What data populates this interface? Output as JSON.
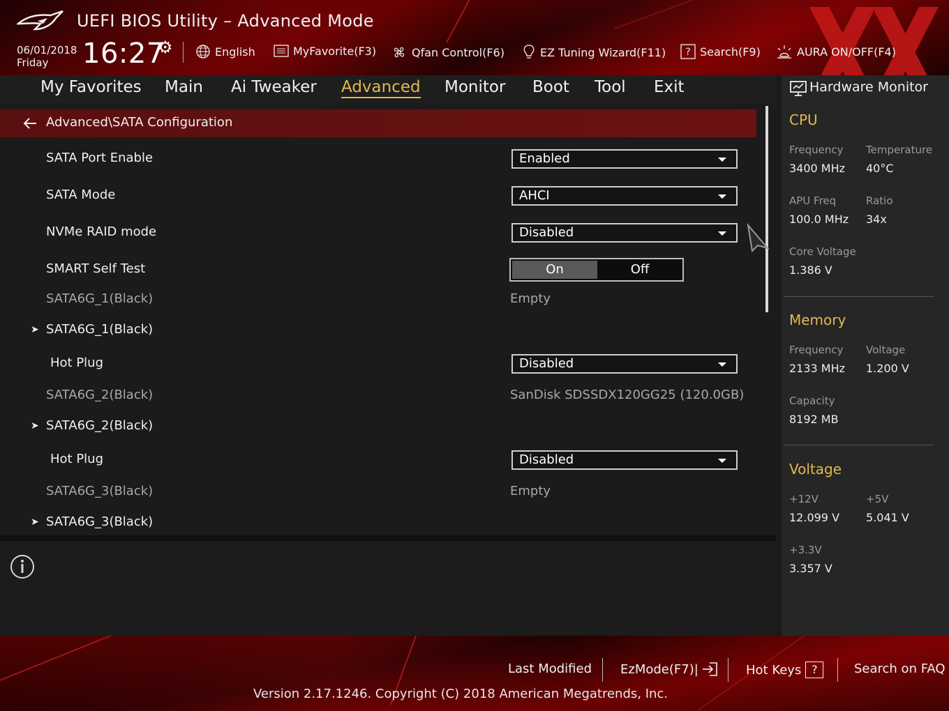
{
  "header": {
    "title": "UEFI BIOS Utility – Advanced Mode",
    "date": "06/01/2018",
    "day": "Friday",
    "time": "16:27",
    "toolbar": [
      {
        "name": "language-button",
        "icon": "globe-icon",
        "label": "English"
      },
      {
        "name": "myfavorite-button",
        "icon": "list-icon",
        "label": "MyFavorite(F3)"
      },
      {
        "name": "qfan-control-button",
        "icon": "fan-icon",
        "label": "Qfan Control(F6)"
      },
      {
        "name": "ez-tuning-wizard-button",
        "icon": "bulb-icon",
        "label": "EZ Tuning Wizard(F11)"
      },
      {
        "name": "search-button",
        "icon": "question-box-icon",
        "label": "Search(F9)"
      },
      {
        "name": "aura-button",
        "icon": "aura-icon",
        "label": "AURA ON/OFF(F4)"
      }
    ]
  },
  "tabs": [
    "My Favorites",
    "Main",
    "Ai Tweaker",
    "Advanced",
    "Monitor",
    "Boot",
    "Tool",
    "Exit"
  ],
  "active_tab": "Advanced",
  "breadcrumb": "Advanced\\SATA Configuration",
  "settings": {
    "sata_port_enable": {
      "label": "SATA Port Enable",
      "value": "Enabled"
    },
    "sata_mode": {
      "label": "SATA Mode",
      "value": "AHCI"
    },
    "nvme_raid_mode": {
      "label": "NVMe RAID mode",
      "value": "Disabled"
    },
    "smart_self_test": {
      "label": "SMART Self Test",
      "on": "On",
      "off": "Off",
      "selected": "On"
    },
    "port1_info": {
      "label": "SATA6G_1(Black)",
      "value": "Empty"
    },
    "port1_submenu": {
      "label": "SATA6G_1(Black)"
    },
    "port1_hotplug": {
      "label": "Hot Plug",
      "value": "Disabled"
    },
    "port2_info": {
      "label": "SATA6G_2(Black)",
      "value": "SanDisk SDSSDX120GG25 (120.0GB)"
    },
    "port2_submenu": {
      "label": "SATA6G_2(Black)"
    },
    "port2_hotplug": {
      "label": "Hot Plug",
      "value": "Disabled"
    },
    "port3_info": {
      "label": "SATA6G_3(Black)",
      "value": "Empty"
    },
    "port3_submenu": {
      "label": "SATA6G_3(Black)"
    }
  },
  "hardware_monitor": {
    "title": "Hardware Monitor",
    "cpu": {
      "heading": "CPU",
      "frequency_label": "Frequency",
      "frequency": "3400 MHz",
      "temperature_label": "Temperature",
      "temperature": "40°C",
      "apu_freq_label": "APU Freq",
      "apu_freq": "100.0 MHz",
      "ratio_label": "Ratio",
      "ratio": "34x",
      "core_voltage_label": "Core Voltage",
      "core_voltage": "1.386 V"
    },
    "memory": {
      "heading": "Memory",
      "frequency_label": "Frequency",
      "frequency": "2133 MHz",
      "voltage_label": "Voltage",
      "voltage": "1.200 V",
      "capacity_label": "Capacity",
      "capacity": "8192 MB"
    },
    "voltage": {
      "heading": "Voltage",
      "v12_label": "+12V",
      "v12": "12.099 V",
      "v5_label": "+5V",
      "v5": "5.041 V",
      "v33_label": "+3.3V",
      "v33": "3.357 V"
    }
  },
  "footer": {
    "last_modified": "Last Modified",
    "ezmode": "EzMode(F7)|",
    "hot_keys": "Hot Keys",
    "hot_keys_key": "?",
    "search_faq": "Search on FAQ",
    "version": "Version 2.17.1246. Copyright (C) 2018 American Megatrends, Inc."
  },
  "colors": {
    "accent": "#e2b94f",
    "breadcrumb_bar": "#6b1212",
    "brand_red": "#c01818"
  }
}
